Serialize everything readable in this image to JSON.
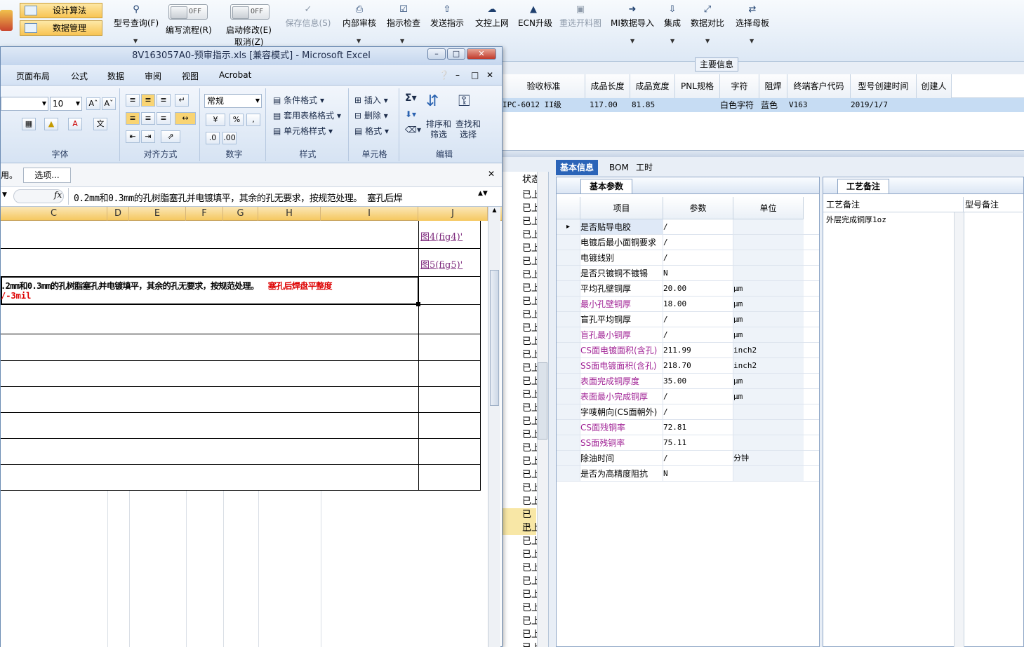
{
  "toolbar": {
    "left_menu": [
      "设计算法",
      "数据管理"
    ],
    "toggles": [
      {
        "state": "OFF",
        "label": "编写流程(R)"
      },
      {
        "state": "OFF",
        "label": "启动修改(E)",
        "sub": "取消(Z)"
      }
    ],
    "buttons": [
      {
        "label": "型号查询(F)",
        "icon": "search-icon"
      },
      {
        "label": "保存信息(S)",
        "icon": "check-icon",
        "disabled": true
      },
      {
        "label": "内部审核",
        "icon": "print-icon"
      },
      {
        "label": "指示检查",
        "icon": "checkbox-icon"
      },
      {
        "label": "发送指示",
        "icon": "upload-icon"
      },
      {
        "label": "文控上网",
        "icon": "cloud-icon"
      },
      {
        "label": "ECN升级",
        "icon": "ecn-icon"
      },
      {
        "label": "重选开料图",
        "icon": "image-icon",
        "disabled": true
      },
      {
        "label": "MI数据导入",
        "icon": "import-icon"
      },
      {
        "label": "集成",
        "icon": "download-icon"
      },
      {
        "label": "数据对比",
        "icon": "compare-icon"
      },
      {
        "label": "选择母板",
        "icon": "shuffle-icon"
      }
    ],
    "main_info": "主要信息"
  },
  "grid": {
    "headers": [
      "验收标准",
      "成品长度",
      "成品宽度",
      "PNL规格",
      "字符",
      "阻焊",
      "终端客户代码",
      "型号创建时间",
      "创建人"
    ],
    "row": {
      "accept": "IPC-6012 II级",
      "length": "117.00",
      "width": "81.85",
      "pnl": "",
      "char": "白色字符",
      "mask": "蓝色",
      "cust": "V163",
      "created": "2019/1/7",
      "creator": ""
    }
  },
  "status": {
    "header": "状态",
    "value": "已上",
    "count": 35
  },
  "tabs": [
    "基本信息",
    "BOM",
    "工时"
  ],
  "basic": {
    "section": "基本参数",
    "headers": [
      "项目",
      "参数",
      "单位"
    ],
    "rows": [
      {
        "item": "是否贴导电胶",
        "val": "/",
        "unit": "",
        "mag": false
      },
      {
        "item": "电镀后最小面铜要求",
        "val": "/",
        "unit": "",
        "mag": false
      },
      {
        "item": "电镀线别",
        "val": "/",
        "unit": "",
        "mag": false
      },
      {
        "item": "是否只镀铜不镀锡",
        "val": "N",
        "unit": "",
        "mag": false
      },
      {
        "item": "平均孔壁铜厚",
        "val": "20.00",
        "unit": "μm",
        "mag": false
      },
      {
        "item": "最小孔壁铜厚",
        "val": "18.00",
        "unit": "μm",
        "mag": true
      },
      {
        "item": "盲孔平均铜厚",
        "val": "/",
        "unit": "μm",
        "mag": false
      },
      {
        "item": "盲孔最小铜厚",
        "val": "/",
        "unit": "μm",
        "mag": true
      },
      {
        "item": "CS面电镀面积(含孔)",
        "val": "211.99",
        "unit": "inch2",
        "mag": true
      },
      {
        "item": "SS面电镀面积(含孔)",
        "val": "218.70",
        "unit": "inch2",
        "mag": true
      },
      {
        "item": "表面完成铜厚度",
        "val": "35.00",
        "unit": "μm",
        "mag": true
      },
      {
        "item": "表面最小完成铜厚",
        "val": "/",
        "unit": "μm",
        "mag": true
      },
      {
        "item": "字唛朝向(CS面朝外)",
        "val": "/",
        "unit": "",
        "mag": false
      },
      {
        "item": "CS面残铜率",
        "val": "72.81",
        "unit": "",
        "mag": true
      },
      {
        "item": "SS面残铜率",
        "val": "75.11",
        "unit": "",
        "mag": true
      },
      {
        "item": "除油时间",
        "val": "/",
        "unit": "分钟",
        "mag": false
      },
      {
        "item": "是否为高精度阻抗",
        "val": "N",
        "unit": "",
        "mag": false
      }
    ]
  },
  "notes": {
    "section": "工艺备注",
    "col1": "工艺备注",
    "col2": "型号备注",
    "text": "外层完成铜厚1oz"
  },
  "excel": {
    "title": "8V163057A0-预审指示.xls [兼容模式] - Microsoft Excel",
    "tabs": [
      "页面布局",
      "公式",
      "数据",
      "审阅",
      "视图",
      "Acrobat"
    ],
    "font_size": "10",
    "number_format": "常规",
    "groups": [
      "字体",
      "对齐方式",
      "数字",
      "样式",
      "单元格",
      "编辑"
    ],
    "style_items": [
      "条件格式",
      "套用表格格式",
      "单元格样式"
    ],
    "cell_items": [
      "插入",
      "删除",
      "格式"
    ],
    "edit_items": [
      "排序和筛选",
      "查找和选择"
    ],
    "msg_prefix": "用。",
    "options_btn": "选项...",
    "formula": "0.2mm和0.3mm的孔树脂塞孔并电镀填平，其余的孔无要求，按规范处理。  塞孔后焊",
    "fx": "fx",
    "cols": [
      "C",
      "D",
      "E",
      "F",
      "G",
      "H",
      "I",
      "J"
    ],
    "link1": "图4(fig4)'",
    "link2": "图5(fig5)'",
    "cell_text": ".2mm和0.3mm的孔树脂塞孔并电镀填平，其余的孔无要求，按规范处理。",
    "cell_red": "塞孔后焊盘平整度",
    "cell_red2": "/-3mil"
  }
}
